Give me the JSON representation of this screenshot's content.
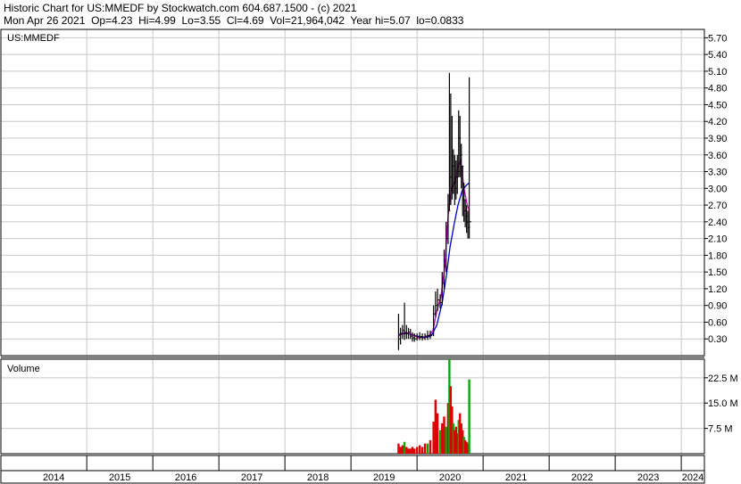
{
  "header": {
    "line1": "Historic Chart for US:MMEDF by Stockwatch.com 604.687.1500 - (c) 2021",
    "line2": "Mon Apr 26 2021  Op=4.23  Hi=4.99  Lo=3.55  Cl=4.69  Vol=21,964,042  Year hi=5.07  lo=0.0833"
  },
  "chart_data": {
    "type": "line",
    "symbol_label": "US:MMEDF",
    "volume_label": "Volume",
    "price_ticks": [
      "5.70",
      "5.40",
      "5.10",
      "4.80",
      "4.50",
      "4.20",
      "3.90",
      "3.60",
      "3.30",
      "3.00",
      "2.70",
      "2.40",
      "2.10",
      "1.80",
      "1.50",
      "1.20",
      "0.90",
      "0.60",
      "0.30"
    ],
    "volume_ticks": [
      "22.5 M",
      "15.0 M",
      "7.5 M"
    ],
    "years": [
      "2014",
      "2015",
      "2016",
      "2017",
      "2018",
      "2019",
      "2020",
      "2021",
      "2022",
      "2023",
      "2024"
    ],
    "xlim": [
      2013.7,
      2024.35
    ],
    "ylim": [
      0,
      5.85
    ],
    "vol_ylim": [
      0,
      28
    ],
    "colors": {
      "price": "#000000",
      "ma_short": "#cc00cc",
      "ma_long": "#0000cc",
      "vol_up": "#00aa00",
      "vol_down": "#dd0000",
      "grid": "#c8c8c8",
      "border": "#000000"
    },
    "price_ohlc": [
      {
        "x": 2019.72,
        "hi": 0.75,
        "lo": 0.1,
        "c": 0.3
      },
      {
        "x": 2019.75,
        "hi": 0.5,
        "lo": 0.2,
        "c": 0.4
      },
      {
        "x": 2019.78,
        "hi": 0.55,
        "lo": 0.3,
        "c": 0.45
      },
      {
        "x": 2019.81,
        "hi": 0.95,
        "lo": 0.28,
        "c": 0.4
      },
      {
        "x": 2019.84,
        "hi": 0.55,
        "lo": 0.3,
        "c": 0.4
      },
      {
        "x": 2019.87,
        "hi": 0.5,
        "lo": 0.3,
        "c": 0.42
      },
      {
        "x": 2019.9,
        "hi": 0.48,
        "lo": 0.3,
        "c": 0.35
      },
      {
        "x": 2019.93,
        "hi": 0.42,
        "lo": 0.25,
        "c": 0.32
      },
      {
        "x": 2019.96,
        "hi": 0.4,
        "lo": 0.25,
        "c": 0.3
      },
      {
        "x": 2020.0,
        "hi": 0.4,
        "lo": 0.27,
        "c": 0.34
      },
      {
        "x": 2020.04,
        "hi": 0.42,
        "lo": 0.28,
        "c": 0.33
      },
      {
        "x": 2020.08,
        "hi": 0.4,
        "lo": 0.27,
        "c": 0.32
      },
      {
        "x": 2020.12,
        "hi": 0.4,
        "lo": 0.28,
        "c": 0.35
      },
      {
        "x": 2020.16,
        "hi": 0.45,
        "lo": 0.28,
        "c": 0.36
      },
      {
        "x": 2020.2,
        "hi": 0.45,
        "lo": 0.3,
        "c": 0.38
      },
      {
        "x": 2020.25,
        "hi": 0.9,
        "lo": 0.35,
        "c": 0.75
      },
      {
        "x": 2020.28,
        "hi": 1.15,
        "lo": 0.7,
        "c": 0.9
      },
      {
        "x": 2020.31,
        "hi": 1.2,
        "lo": 0.8,
        "c": 1.0
      },
      {
        "x": 2020.35,
        "hi": 1.1,
        "lo": 0.85,
        "c": 0.95
      },
      {
        "x": 2020.38,
        "hi": 1.5,
        "lo": 0.9,
        "c": 1.3
      },
      {
        "x": 2020.41,
        "hi": 1.9,
        "lo": 1.2,
        "c": 1.6
      },
      {
        "x": 2020.44,
        "hi": 2.4,
        "lo": 1.5,
        "c": 2.1
      },
      {
        "x": 2020.47,
        "hi": 2.9,
        "lo": 2.0,
        "c": 2.6
      },
      {
        "x": 2020.49,
        "hi": 5.07,
        "lo": 2.6,
        "c": 3.2
      },
      {
        "x": 2020.51,
        "hi": 4.7,
        "lo": 2.7,
        "c": 3.0
      },
      {
        "x": 2020.53,
        "hi": 4.3,
        "lo": 2.8,
        "c": 3.4
      },
      {
        "x": 2020.55,
        "hi": 3.7,
        "lo": 2.9,
        "c": 3.1
      },
      {
        "x": 2020.57,
        "hi": 3.6,
        "lo": 2.7,
        "c": 3.0
      },
      {
        "x": 2020.59,
        "hi": 3.5,
        "lo": 2.8,
        "c": 3.2
      },
      {
        "x": 2020.61,
        "hi": 3.6,
        "lo": 2.9,
        "c": 3.3
      },
      {
        "x": 2020.63,
        "hi": 4.4,
        "lo": 3.2,
        "c": 3.9
      },
      {
        "x": 2020.65,
        "hi": 4.3,
        "lo": 3.2,
        "c": 3.6
      },
      {
        "x": 2020.67,
        "hi": 3.8,
        "lo": 3.0,
        "c": 3.4
      },
      {
        "x": 2020.69,
        "hi": 3.4,
        "lo": 2.5,
        "c": 2.8
      },
      {
        "x": 2020.71,
        "hi": 3.1,
        "lo": 2.4,
        "c": 2.6
      },
      {
        "x": 2020.73,
        "hi": 2.8,
        "lo": 2.3,
        "c": 2.5
      },
      {
        "x": 2020.75,
        "hi": 2.7,
        "lo": 2.2,
        "c": 2.4
      },
      {
        "x": 2020.77,
        "hi": 2.6,
        "lo": 2.1,
        "c": 2.3
      },
      {
        "x": 2020.79,
        "hi": 4.99,
        "lo": 2.1,
        "c": 2.4
      }
    ],
    "ma_short": [
      {
        "x": 2019.72,
        "y": 0.35
      },
      {
        "x": 2019.82,
        "y": 0.42
      },
      {
        "x": 2019.92,
        "y": 0.38
      },
      {
        "x": 2020.02,
        "y": 0.32
      },
      {
        "x": 2020.1,
        "y": 0.33
      },
      {
        "x": 2020.18,
        "y": 0.36
      },
      {
        "x": 2020.24,
        "y": 0.45
      },
      {
        "x": 2020.3,
        "y": 0.8
      },
      {
        "x": 2020.36,
        "y": 1.05
      },
      {
        "x": 2020.42,
        "y": 1.6
      },
      {
        "x": 2020.47,
        "y": 2.5
      },
      {
        "x": 2020.52,
        "y": 3.0
      },
      {
        "x": 2020.57,
        "y": 3.1
      },
      {
        "x": 2020.62,
        "y": 3.4
      },
      {
        "x": 2020.66,
        "y": 3.5
      },
      {
        "x": 2020.71,
        "y": 3.0
      },
      {
        "x": 2020.76,
        "y": 2.7
      },
      {
        "x": 2020.79,
        "y": 2.6
      }
    ],
    "ma_long": [
      {
        "x": 2019.72,
        "y": 0.38
      },
      {
        "x": 2019.85,
        "y": 0.4
      },
      {
        "x": 2020.0,
        "y": 0.35
      },
      {
        "x": 2020.15,
        "y": 0.33
      },
      {
        "x": 2020.22,
        "y": 0.36
      },
      {
        "x": 2020.3,
        "y": 0.55
      },
      {
        "x": 2020.38,
        "y": 0.95
      },
      {
        "x": 2020.44,
        "y": 1.4
      },
      {
        "x": 2020.5,
        "y": 1.95
      },
      {
        "x": 2020.56,
        "y": 2.35
      },
      {
        "x": 2020.62,
        "y": 2.7
      },
      {
        "x": 2020.68,
        "y": 2.95
      },
      {
        "x": 2020.74,
        "y": 3.05
      },
      {
        "x": 2020.79,
        "y": 3.1
      }
    ],
    "volume": [
      {
        "x": 2019.72,
        "v": 3.0,
        "up": false
      },
      {
        "x": 2019.75,
        "v": 2.0,
        "up": false
      },
      {
        "x": 2019.78,
        "v": 2.5,
        "up": false
      },
      {
        "x": 2019.81,
        "v": 3.5,
        "up": true
      },
      {
        "x": 2019.84,
        "v": 2.0,
        "up": false
      },
      {
        "x": 2019.87,
        "v": 1.5,
        "up": false
      },
      {
        "x": 2019.9,
        "v": 1.5,
        "up": false
      },
      {
        "x": 2019.93,
        "v": 2.0,
        "up": false
      },
      {
        "x": 2019.96,
        "v": 1.5,
        "up": false
      },
      {
        "x": 2020.0,
        "v": 2.0,
        "up": false
      },
      {
        "x": 2020.04,
        "v": 2.5,
        "up": false
      },
      {
        "x": 2020.08,
        "v": 2.0,
        "up": false
      },
      {
        "x": 2020.12,
        "v": 3.0,
        "up": false
      },
      {
        "x": 2020.16,
        "v": 3.0,
        "up": true
      },
      {
        "x": 2020.2,
        "v": 4.0,
        "up": false
      },
      {
        "x": 2020.25,
        "v": 9.5,
        "up": false
      },
      {
        "x": 2020.28,
        "v": 16.0,
        "up": false
      },
      {
        "x": 2020.31,
        "v": 12.0,
        "up": false
      },
      {
        "x": 2020.35,
        "v": 7.0,
        "up": true
      },
      {
        "x": 2020.38,
        "v": 9.0,
        "up": false
      },
      {
        "x": 2020.41,
        "v": 11.0,
        "up": false
      },
      {
        "x": 2020.44,
        "v": 8.0,
        "up": true
      },
      {
        "x": 2020.47,
        "v": 15.0,
        "up": false
      },
      {
        "x": 2020.49,
        "v": 28.0,
        "up": true
      },
      {
        "x": 2020.51,
        "v": 20.0,
        "up": false
      },
      {
        "x": 2020.53,
        "v": 14.0,
        "up": false
      },
      {
        "x": 2020.55,
        "v": 9.0,
        "up": true
      },
      {
        "x": 2020.57,
        "v": 7.0,
        "up": false
      },
      {
        "x": 2020.59,
        "v": 8.0,
        "up": false
      },
      {
        "x": 2020.61,
        "v": 6.0,
        "up": false
      },
      {
        "x": 2020.63,
        "v": 10.0,
        "up": true
      },
      {
        "x": 2020.65,
        "v": 12.0,
        "up": false
      },
      {
        "x": 2020.67,
        "v": 9.0,
        "up": false
      },
      {
        "x": 2020.69,
        "v": 7.0,
        "up": false
      },
      {
        "x": 2020.71,
        "v": 5.0,
        "up": true
      },
      {
        "x": 2020.73,
        "v": 4.0,
        "up": false
      },
      {
        "x": 2020.75,
        "v": 3.5,
        "up": false
      },
      {
        "x": 2020.77,
        "v": 3.0,
        "up": false
      },
      {
        "x": 2020.79,
        "v": 22.0,
        "up": true
      }
    ]
  }
}
